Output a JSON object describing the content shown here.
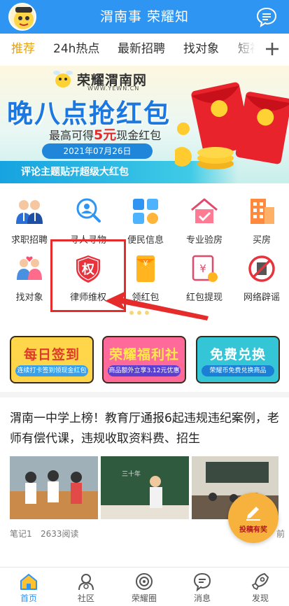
{
  "header": {
    "title": "渭南事  荣耀知",
    "logo_icon": "mascot-logo-icon",
    "message_icon": "chat-bubble-icon"
  },
  "tabs": [
    {
      "label": "推荐",
      "active": true
    },
    {
      "label": "24h热点"
    },
    {
      "label": "最新招聘"
    },
    {
      "label": "找对象"
    },
    {
      "label": "短视"
    }
  ],
  "banner": {
    "site": "荣耀渭南网",
    "url": "WWW.YEWN.CN",
    "title": "晚八点抢红包",
    "subtitle_prefix": "最高可得",
    "subtitle_amount": "5元",
    "subtitle_suffix": "现金红包",
    "date": "2021年07月26日",
    "footer": "评论主题贴开超级大红包"
  },
  "grid": [
    {
      "label": "求职招聘",
      "icon": "job-people-icon"
    },
    {
      "label": "寻人寻物",
      "icon": "search-person-icon"
    },
    {
      "label": "便民信息",
      "icon": "info-grid-icon"
    },
    {
      "label": "专业验房",
      "icon": "house-check-icon"
    },
    {
      "label": "买房",
      "icon": "building-icon"
    },
    {
      "label": "找对象",
      "icon": "couple-icon"
    },
    {
      "label": "律师维权",
      "icon": "rights-shield-icon"
    },
    {
      "label": "领红包",
      "icon": "red-envelope-icon"
    },
    {
      "label": "红包提现",
      "icon": "withdraw-icon"
    },
    {
      "label": "网络辟谣",
      "icon": "no-rumor-icon"
    }
  ],
  "highlight": {
    "color": "#e62b2b",
    "target": "律师维权"
  },
  "promos": [
    {
      "title": "每日签到",
      "sub": "连续打卡签到领现金红包",
      "bg": "#ffd54a",
      "title_color": "#e03a2a",
      "sub_bg": "#3aa0ea"
    },
    {
      "title": "荣耀福利社",
      "sub": "商品额外立享3.12元优惠",
      "bg": "#ff6a9a",
      "title_color": "#ffe94a",
      "sub_bg": "#5a3fd0"
    },
    {
      "title": "免费兑换",
      "sub": "荣耀币免费兑换商品",
      "bg": "#34c6d6",
      "title_color": "#ffffff",
      "sub_bg": "#1b7fd6"
    }
  ],
  "article": {
    "title": "渭南一中学上榜！教育厅通报6起违规违纪案例，老师有偿代课，违规收取资料费、招生",
    "author": "笔记1",
    "reads": "2633阅读",
    "time": "前"
  },
  "post_button": {
    "label": "投稿有奖",
    "icon": "pen-write-icon"
  },
  "bottom_nav": [
    {
      "label": "首页",
      "icon": "home-icon",
      "active": true
    },
    {
      "label": "社区",
      "icon": "community-icon"
    },
    {
      "label": "荣耀圈",
      "icon": "circle-eye-icon"
    },
    {
      "label": "消息",
      "icon": "message-icon"
    },
    {
      "label": "发现",
      "icon": "rocket-icon"
    }
  ],
  "colors": {
    "primary": "#2e95f3",
    "accent": "#e8a20c",
    "red": "#e62b2b"
  }
}
